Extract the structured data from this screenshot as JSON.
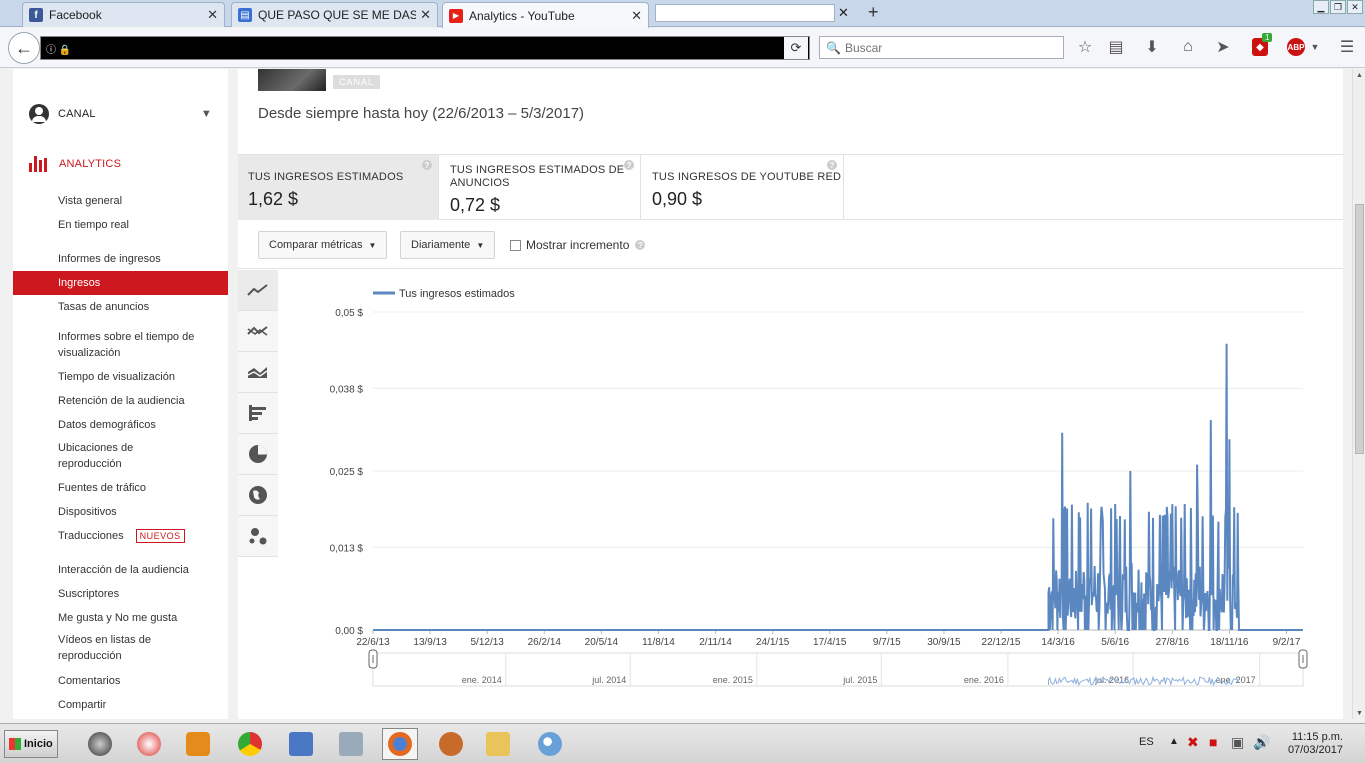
{
  "browser": {
    "tabs": [
      {
        "label": "Facebook",
        "favicon_color": "#3b5998",
        "favicon_glyph": "f"
      },
      {
        "label": "QUE PASO QUE SE ME DASA...",
        "favicon_color": "#3b6fd4",
        "favicon_glyph": "▤"
      },
      {
        "label": "Analytics - YouTube",
        "favicon_color": "#e62117",
        "favicon_glyph": "▶"
      }
    ],
    "search_placeholder": "Buscar",
    "ublock_badge": "1",
    "abp_label": "ABP"
  },
  "sidebar": {
    "canal": "CANAL",
    "analytics": "ANALYTICS",
    "items": [
      "Vista general",
      "En tiempo real",
      "Informes de ingresos",
      "Ingresos",
      "Tasas de anuncios",
      "Informes sobre el tiempo de",
      "visualización",
      "Tiempo de visualización",
      "Retención de la audiencia",
      "Datos demográficos",
      "Ubicaciones de",
      "reproducción",
      "Fuentes de tráfico",
      "Dispositivos",
      "Traducciones",
      "Interacción de la audiencia",
      "Suscriptores",
      "Me gusta y No me gusta",
      "Vídeos en listas de",
      "reproducción",
      "Comentarios",
      "Compartir"
    ],
    "badge_new": "NUEVOS"
  },
  "main": {
    "canal_chip": "CANAL",
    "date_range": "Desde siempre hasta hoy (22/6/2013 – 5/3/2017)",
    "metrics": [
      {
        "label": "TUS INGRESOS ESTIMADOS",
        "value": "1,62 $"
      },
      {
        "label": "TUS INGRESOS ESTIMADOS DE",
        "label2": "ANUNCIOS",
        "value": "0,72 $"
      },
      {
        "label": "TUS INGRESOS DE YOUTUBE RED",
        "value": "0,90 $"
      }
    ],
    "controls": {
      "compare": "Comparar métricas",
      "interval": "Diariamente",
      "show_increment": "Mostrar incremento"
    }
  },
  "chart_data": {
    "type": "line",
    "series": [
      {
        "name": "Tus ingresos estimados",
        "color": "#5b87c1"
      }
    ],
    "y_tick_labels": [
      "0,00 $",
      "0,013 $",
      "0,025 $",
      "0,038 $",
      "0,05 $"
    ],
    "y_ticks": [
      0,
      0.013,
      0.025,
      0.038,
      0.05
    ],
    "ylim": [
      0,
      0.05
    ],
    "x_tick_labels": [
      "22/6/13",
      "13/9/13",
      "5/12/13",
      "26/2/14",
      "20/5/14",
      "11/8/14",
      "2/11/14",
      "24/1/15",
      "17/4/15",
      "9/7/15",
      "30/9/15",
      "22/12/15",
      "14/3/16",
      "5/6/16",
      "27/8/16",
      "18/11/16",
      "9/2/17"
    ],
    "x_range": [
      "22/6/2013",
      "5/3/2017"
    ],
    "active_segment": {
      "start": "29/2/16",
      "end": "1/12/16"
    },
    "peaks": [
      {
        "date": "20/3/16",
        "value": 0.031
      },
      {
        "date": "26/4/16",
        "value": 0.02
      },
      {
        "date": "27/6/16",
        "value": 0.025
      },
      {
        "date": "2/10/16",
        "value": 0.026
      },
      {
        "date": "22/10/16",
        "value": 0.033
      },
      {
        "date": "14/11/16",
        "value": 0.045
      },
      {
        "date": "18/11/16",
        "value": 0.03
      }
    ],
    "navigator_labels": [
      "ene. 2014",
      "jul. 2014",
      "ene. 2015",
      "jul. 2015",
      "ene. 2016",
      "jul. 2016",
      "ene. 2017"
    ],
    "grid": true,
    "legend_position": "top-left"
  },
  "taskbar": {
    "start": "Inicio",
    "lang": "ES",
    "time": "11:15 p.m.",
    "date": "07/03/2017"
  }
}
